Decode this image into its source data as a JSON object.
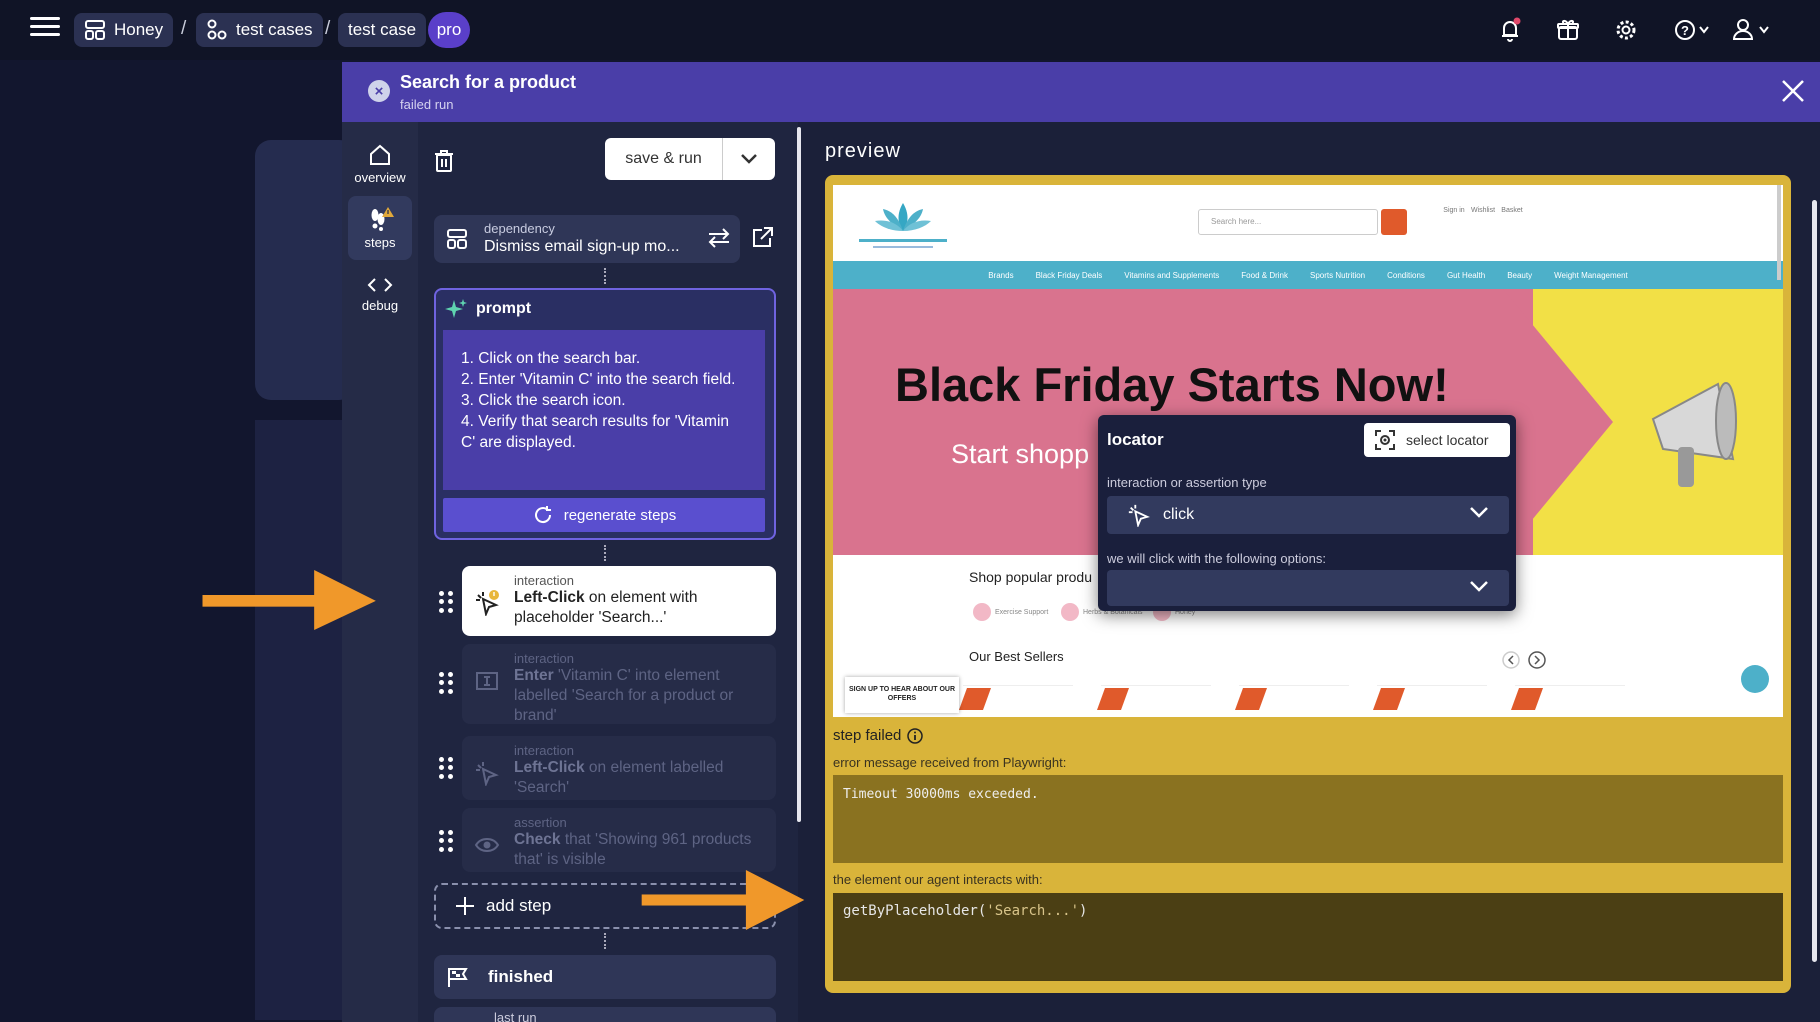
{
  "topbar": {
    "crumbs": [
      "Honey",
      "test cases",
      "test case"
    ],
    "separator": "/",
    "badge": "pro"
  },
  "modal": {
    "title": "Search for a product",
    "subtitle": "failed run"
  },
  "rail": {
    "items": [
      {
        "label": "overview",
        "icon": "home-icon"
      },
      {
        "label": "steps",
        "icon": "footsteps-icon"
      },
      {
        "label": "debug",
        "icon": "code-icon"
      }
    ]
  },
  "toolbar": {
    "save_run_label": "save & run"
  },
  "dependency": {
    "kind": "dependency",
    "name": "Dismiss email sign-up mo..."
  },
  "prompt": {
    "title": "prompt",
    "lines": [
      "1. Click on the search bar.",
      "2. Enter 'Vitamin C' into the search field.",
      "3. Click the search icon.",
      "4. Verify that search results for 'Vitamin C' are displayed."
    ],
    "regenerate_label": "regenerate steps"
  },
  "steps": [
    {
      "type": "interaction",
      "action": "Left-Click",
      "rest": " on element with placeholder 'Search...'",
      "state": "active"
    },
    {
      "type": "interaction",
      "action": "Enter",
      "rest": " 'Vitamin C' into element labelled 'Search for a product or brand'",
      "state": "dim"
    },
    {
      "type": "interaction",
      "action": "Left-Click",
      "rest": " on element labelled 'Search'",
      "state": "dim"
    },
    {
      "type": "assertion",
      "action": "Check",
      "rest": " that 'Showing 961 products that' is visible",
      "state": "dim"
    }
  ],
  "add_step_label": "add step",
  "finished_label": "finished",
  "last_run_label": "last run",
  "preview": {
    "title": "preview",
    "site": {
      "search_placeholder": "Search here...",
      "nav": [
        "Brands",
        "Black Friday Deals",
        "Vitamins and Supplements",
        "Food & Drink",
        "Sports Nutrition",
        "Conditions",
        "Gut Health",
        "Beauty",
        "Weight Management"
      ],
      "headline": "Black Friday Starts Now!",
      "subline": "Start shopp",
      "shop_popular": "Shop popular produ",
      "pills": [
        "Exercise Support",
        "Herbs & Botanicals",
        "Honey"
      ],
      "best_sellers": "Our Best Sellers",
      "signup": "SIGN UP TO HEAR ABOUT OUR OFFERS",
      "user_icons": [
        "Sign in",
        "Wishlist",
        "Basket"
      ]
    },
    "locator": {
      "title": "locator",
      "select_label": "select locator",
      "type_label": "interaction or assertion type",
      "type_value": "click",
      "options_label": "we will click with the following options:"
    },
    "failure": {
      "title": "step failed",
      "error_label": "error message received from Playwright:",
      "error_message": "Timeout 30000ms exceeded.",
      "element_label": "the element our agent interacts with:",
      "code_fn": "getByPlaceholder(",
      "code_arg": "'Search...'",
      "code_end": ")"
    }
  },
  "colors": {
    "accent": "#4a3ea8",
    "arrow": "#f0982a",
    "preview_frame": "#d9b43a"
  }
}
